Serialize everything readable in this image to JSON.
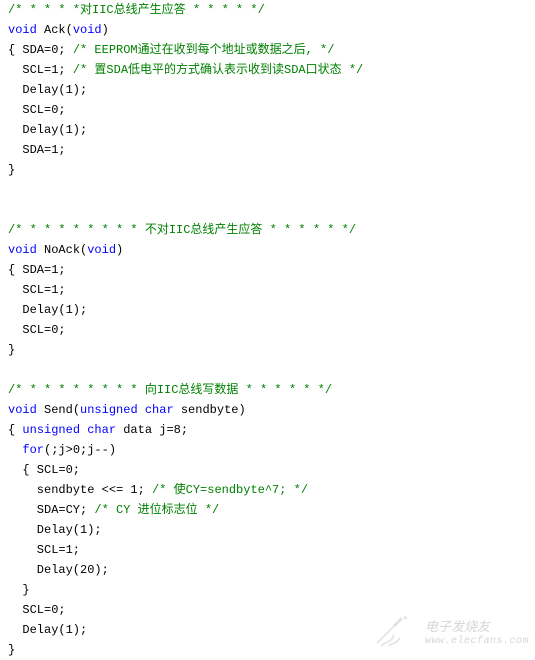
{
  "block1": {
    "l1_c": "/* * * * *对IIC总线产生应答 * * * * */",
    "l2_kw1": "void",
    "l2_fn": " Ack(",
    "l2_kw2": "void",
    "l2_end": ")",
    "l3_a": "{ SDA=0; ",
    "l3_c": "/* EEPROM通过在收到每个地址或数据之后, */",
    "l4_a": "  SCL=1; ",
    "l4_c": "/* 置SDA低电平的方式确认表示收到读SDA口状态 */",
    "l5": "  Delay(1);",
    "l6": "  SCL=0;",
    "l7": "  Delay(1);",
    "l8": "  SDA=1;",
    "l9": "}"
  },
  "block2": {
    "l1_c": "/* * * * * * * * * 不对IIC总线产生应答 * * * * * */",
    "l2_kw1": "void",
    "l2_fn": " NoAck(",
    "l2_kw2": "void",
    "l2_end": ")",
    "l3": "{ SDA=1;",
    "l4": "  SCL=1;",
    "l5": "  Delay(1);",
    "l6": "  SCL=0;",
    "l7": "}"
  },
  "block3": {
    "l1_c": "/* * * * * * * * * 向IIC总线写数据 * * * * * */",
    "l2_kw1": "void",
    "l2_fn": " Send(",
    "l2_kw2": "unsigned",
    "l2_sp": " ",
    "l2_kw3": "char",
    "l2_arg": " sendbyte)",
    "l3_a": "{ ",
    "l3_kw1": "unsigned",
    "l3_sp": " ",
    "l3_kw2": "char",
    "l3_b": " data j=8;",
    "l4_a": "  ",
    "l4_kw": "for",
    "l4_b": "(;j>0;j--)",
    "l5": "  { SCL=0;",
    "l6_a": "    sendbyte <<= 1; ",
    "l6_c": "/* 使CY=sendbyte^7; */",
    "l7_a": "    SDA=CY; ",
    "l7_c": "/* CY 进位标志位 */",
    "l8": "    Delay(1);",
    "l9": "    SCL=1;",
    "l10": "    Delay(20);",
    "l11": "  }",
    "l12": "  SCL=0;",
    "l13": "  Delay(1);",
    "l14": "}"
  },
  "watermark": {
    "cn": "电子发烧友",
    "url": "www.elecfans.com"
  }
}
